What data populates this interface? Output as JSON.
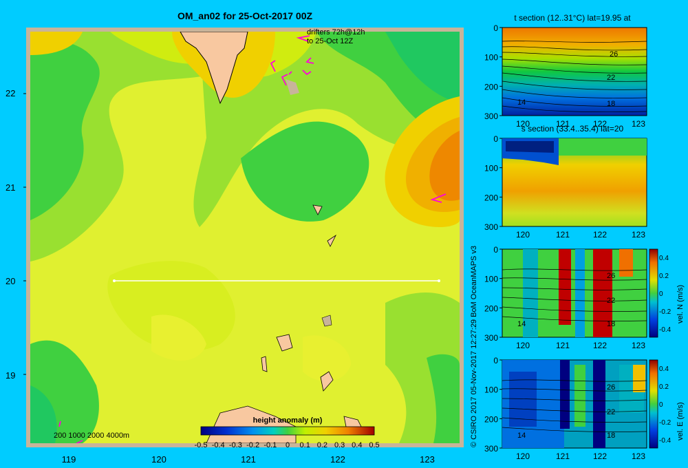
{
  "main_map": {
    "title": "OM_an02 for 25-Oct-2017 00Z",
    "drifters_line1": "drifters 72h@12h",
    "drifters_line2": "to 25-Oct 12Z",
    "depth_legend": "200  1000  2000  4000m",
    "section_line_label": "",
    "colorbar_title": "height anomaly  (m)",
    "colorbar_ticks": [
      "-0.5",
      "-0.4",
      "-0.3",
      "-0.2",
      "-0.1",
      "0",
      "0.1",
      "0.2",
      "0.3",
      "0.4",
      "0.5"
    ],
    "x_ticks": [
      "119",
      "120",
      "121",
      "122",
      "123"
    ],
    "y_ticks": [
      "22",
      "21",
      "20",
      "19"
    ],
    "credit": "© CSIRO 2017   05-Nov-2017 12:27:29 BoM OceanMAPS v3"
  },
  "panels": [
    {
      "title": "t section (12..31°C) lat=19.95 at",
      "contour_labels": [
        "26",
        "22",
        "18",
        "14"
      ],
      "y_ticks": [
        "0",
        "100",
        "200",
        "300"
      ],
      "x_ticks": [
        "120",
        "121",
        "122",
        "123"
      ]
    },
    {
      "title": "s section (33.4..35.4) lat=20",
      "contour_labels": [],
      "y_ticks": [
        "0",
        "100",
        "200",
        "300"
      ],
      "x_ticks": [
        "120",
        "121",
        "122",
        "123"
      ]
    },
    {
      "title": "",
      "contour_labels": [
        "26",
        "22",
        "18",
        "14"
      ],
      "y_ticks": [
        "0",
        "100",
        "200",
        "300"
      ],
      "x_ticks": [
        "120",
        "121",
        "122",
        "123"
      ],
      "cbar_label": "vel. N (m/s)",
      "cbar_ticks": [
        "0.4",
        "0.2",
        "0",
        "-0.2",
        "-0.4"
      ]
    },
    {
      "title": "",
      "contour_labels": [
        "26",
        "22",
        "18",
        "14"
      ],
      "y_ticks": [
        "0",
        "100",
        "200",
        "300"
      ],
      "x_ticks": [
        "120",
        "121",
        "122",
        "123"
      ],
      "cbar_label": "vel. E (m/s)",
      "cbar_ticks": [
        "0.4",
        "0.2",
        "0",
        "-0.2",
        "-0.4"
      ]
    }
  ],
  "chart_data": [
    {
      "type": "heatmap",
      "title": "OM_an02 for 25-Oct-2017 00Z",
      "xlabel": "",
      "ylabel": "",
      "xlim": [
        118.5,
        123.5
      ],
      "ylim": [
        18.3,
        22.7
      ],
      "x_ticks": [
        119,
        120,
        121,
        122,
        123
      ],
      "y_ticks": [
        19,
        20,
        21,
        22
      ],
      "colorbar": {
        "label": "height anomaly  (m)",
        "range": [
          -0.5,
          0.5
        ],
        "ticks": [
          -0.5,
          -0.4,
          -0.3,
          -0.2,
          -0.1,
          0,
          0.1,
          0.2,
          0.3,
          0.4,
          0.5
        ]
      },
      "section_line": {
        "lat": 20,
        "lon_from": 119.5,
        "lon_to": 123.2
      },
      "approx_field": [
        {
          "region": "NE corner",
          "value": 0.2
        },
        {
          "region": "north",
          "value": 0.1
        },
        {
          "region": "central",
          "value": 0.05
        },
        {
          "region": "west band",
          "value": -0.05
        }
      ]
    },
    {
      "type": "heatmap",
      "title": "t section (12..31°C) lat=19.95 at",
      "xlim": [
        119.6,
        123.2
      ],
      "ylim": [
        300,
        0
      ],
      "x_ticks": [
        120,
        121,
        122,
        123
      ],
      "y_ticks": [
        0,
        100,
        200,
        300
      ],
      "contours": [
        26,
        22,
        18,
        14
      ]
    },
    {
      "type": "heatmap",
      "title": "s section (33.4..35.4) lat=20",
      "xlim": [
        119.6,
        123.2
      ],
      "ylim": [
        300,
        0
      ],
      "x_ticks": [
        120,
        121,
        122,
        123
      ],
      "y_ticks": [
        0,
        100,
        200,
        300
      ]
    },
    {
      "type": "heatmap",
      "title": "",
      "xlim": [
        119.6,
        123.2
      ],
      "ylim": [
        300,
        0
      ],
      "x_ticks": [
        120,
        121,
        122,
        123
      ],
      "y_ticks": [
        0,
        100,
        200,
        300
      ],
      "colorbar": {
        "label": "vel. N (m/s)",
        "range": [
          -0.4,
          0.4
        ]
      },
      "contours": [
        26,
        22,
        18,
        14
      ]
    },
    {
      "type": "heatmap",
      "title": "",
      "xlim": [
        119.6,
        123.2
      ],
      "ylim": [
        300,
        0
      ],
      "x_ticks": [
        120,
        121,
        122,
        123
      ],
      "y_ticks": [
        0,
        100,
        200,
        300
      ],
      "colorbar": {
        "label": "vel. E (m/s)",
        "range": [
          -0.4,
          0.4
        ]
      },
      "contours": [
        26,
        22,
        18,
        14
      ]
    }
  ]
}
